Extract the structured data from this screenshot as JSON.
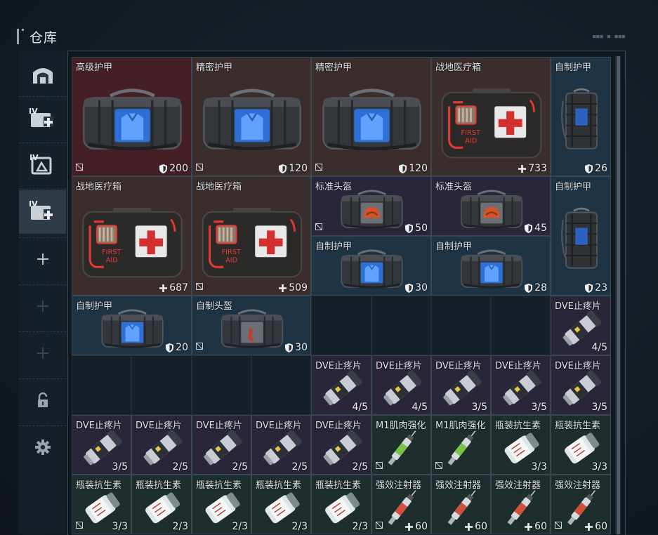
{
  "header": {
    "title": "仓库",
    "deco": "■■■ ■ ■■■"
  },
  "sidebar": [
    {
      "id": "base",
      "icon": "base-icon",
      "active": false
    },
    {
      "id": "medical-iv-1",
      "icon": "medical-iv-icon",
      "active": false,
      "label": "IV"
    },
    {
      "id": "medical-iv-2",
      "icon": "medical-iv-outline-icon",
      "active": false,
      "label": "IV"
    },
    {
      "id": "medical-iv-3",
      "icon": "medical-iv-icon",
      "active": true,
      "label": "IV"
    },
    {
      "id": "add-1",
      "icon": "plus-icon",
      "active": false
    },
    {
      "id": "add-2",
      "icon": "plus-dim-icon",
      "active": false
    },
    {
      "id": "add-3",
      "icon": "plus-dim-icon",
      "active": false
    },
    {
      "id": "lock",
      "icon": "lock-icon",
      "active": false
    },
    {
      "id": "settings",
      "icon": "gear-icon",
      "active": false
    }
  ],
  "colors": {
    "red": "#442026",
    "brown": "#3b2d2b",
    "blue": "#1e3344",
    "purple": "#2a2639",
    "green": "#1d2e2d",
    "accent": "#e53935"
  },
  "items": [
    {
      "name": "高级护甲",
      "qty": "200",
      "qtyIcon": "shield-icon",
      "kind": "bag-blue",
      "bg": "red",
      "flag": true,
      "col": 0,
      "row": 0,
      "w": 2,
      "h": 2
    },
    {
      "name": "精密护甲",
      "qty": "120",
      "qtyIcon": "shield-icon",
      "kind": "bag-blue",
      "bg": "brown",
      "flag": true,
      "col": 2,
      "row": 0,
      "w": 2,
      "h": 2
    },
    {
      "name": "精密护甲",
      "qty": "120",
      "qtyIcon": "shield-icon",
      "kind": "bag-blue",
      "bg": "brown",
      "flag": true,
      "col": 4,
      "row": 0,
      "w": 2,
      "h": 2
    },
    {
      "name": "战地医疗箱",
      "qty": "733",
      "qtyIcon": "plus-icon",
      "kind": "medkit",
      "bg": "brown",
      "flag": false,
      "col": 6,
      "row": 0,
      "w": 2,
      "h": 2
    },
    {
      "name": "自制护甲",
      "qty": "26",
      "qtyIcon": "shield-icon",
      "kind": "backpack",
      "bg": "blue",
      "flag": false,
      "col": 8,
      "row": 0,
      "w": 1,
      "h": 2
    },
    {
      "name": "战地医疗箱",
      "qty": "687",
      "qtyIcon": "plus-icon",
      "kind": "medkit",
      "bg": "brown",
      "flag": false,
      "col": 0,
      "row": 2,
      "w": 2,
      "h": 2
    },
    {
      "name": "战地医疗箱",
      "qty": "509",
      "qtyIcon": "plus-icon",
      "kind": "medkit",
      "bg": "brown",
      "flag": true,
      "col": 2,
      "row": 2,
      "w": 2,
      "h": 2
    },
    {
      "name": "标准头盔",
      "qty": "50",
      "qtyIcon": "shield-icon",
      "kind": "bag-helmet",
      "bg": "purple",
      "flag": true,
      "col": 4,
      "row": 2,
      "w": 2,
      "h": 1
    },
    {
      "name": "标准头盔",
      "qty": "45",
      "qtyIcon": "shield-icon",
      "kind": "bag-helmet",
      "bg": "purple",
      "flag": false,
      "col": 6,
      "row": 2,
      "w": 2,
      "h": 1
    },
    {
      "name": "自制护甲",
      "qty": "23",
      "qtyIcon": "shield-icon",
      "kind": "backpack",
      "bg": "blue",
      "flag": false,
      "col": 8,
      "row": 2,
      "w": 1,
      "h": 2
    },
    {
      "name": "自制护甲",
      "qty": "30",
      "qtyIcon": "shield-icon",
      "kind": "bag-small",
      "bg": "blue",
      "flag": false,
      "col": 4,
      "row": 3,
      "w": 2,
      "h": 1
    },
    {
      "name": "自制护甲",
      "qty": "28",
      "qtyIcon": "shield-icon",
      "kind": "bag-small",
      "bg": "blue",
      "flag": false,
      "col": 6,
      "row": 3,
      "w": 2,
      "h": 1
    },
    {
      "name": "自制护甲",
      "qty": "20",
      "qtyIcon": "shield-icon",
      "kind": "bag-small",
      "bg": "blue",
      "flag": false,
      "col": 0,
      "row": 4,
      "w": 2,
      "h": 1
    },
    {
      "name": "自制头盔",
      "qty": "30",
      "qtyIcon": "shield-icon",
      "kind": "bag-small-red",
      "bg": "blue",
      "flag": true,
      "col": 2,
      "row": 4,
      "w": 2,
      "h": 1
    },
    {
      "name": "DVE止疼片",
      "qty": "4/5",
      "qtyIcon": "",
      "kind": "pill",
      "bg": "purple",
      "flag": false,
      "col": 8,
      "row": 4,
      "w": 1,
      "h": 1
    },
    {
      "name": "DVE止疼片",
      "qty": "4/5",
      "qtyIcon": "",
      "kind": "pill",
      "bg": "purple",
      "flag": false,
      "col": 4,
      "row": 5,
      "w": 1,
      "h": 1
    },
    {
      "name": "DVE止疼片",
      "qty": "4/5",
      "qtyIcon": "",
      "kind": "pill",
      "bg": "purple",
      "flag": false,
      "col": 5,
      "row": 5,
      "w": 1,
      "h": 1
    },
    {
      "name": "DVE止疼片",
      "qty": "3/5",
      "qtyIcon": "",
      "kind": "pill",
      "bg": "purple",
      "flag": false,
      "col": 6,
      "row": 5,
      "w": 1,
      "h": 1
    },
    {
      "name": "DVE止疼片",
      "qty": "3/5",
      "qtyIcon": "",
      "kind": "pill",
      "bg": "purple",
      "flag": false,
      "col": 7,
      "row": 5,
      "w": 1,
      "h": 1
    },
    {
      "name": "DVE止疼片",
      "qty": "3/5",
      "qtyIcon": "",
      "kind": "pill",
      "bg": "purple",
      "flag": false,
      "col": 8,
      "row": 5,
      "w": 1,
      "h": 1
    },
    {
      "name": "DVE止疼片",
      "qty": "3/5",
      "qtyIcon": "",
      "kind": "pill",
      "bg": "purple",
      "flag": false,
      "col": 0,
      "row": 6,
      "w": 1,
      "h": 1
    },
    {
      "name": "DVE止疼片",
      "qty": "2/5",
      "qtyIcon": "",
      "kind": "pill",
      "bg": "purple",
      "flag": false,
      "col": 1,
      "row": 6,
      "w": 1,
      "h": 1
    },
    {
      "name": "DVE止疼片",
      "qty": "2/5",
      "qtyIcon": "",
      "kind": "pill",
      "bg": "purple",
      "flag": false,
      "col": 2,
      "row": 6,
      "w": 1,
      "h": 1
    },
    {
      "name": "DVE止疼片",
      "qty": "2/5",
      "qtyIcon": "",
      "kind": "pill",
      "bg": "purple",
      "flag": false,
      "col": 3,
      "row": 6,
      "w": 1,
      "h": 1
    },
    {
      "name": "DVE止疼片",
      "qty": "2/5",
      "qtyIcon": "",
      "kind": "pill",
      "bg": "purple",
      "flag": false,
      "col": 4,
      "row": 6,
      "w": 1,
      "h": 1
    },
    {
      "name": "M1肌肉强化",
      "qty": "",
      "qtyIcon": "",
      "kind": "syringe-green",
      "bg": "green",
      "flag": true,
      "col": 5,
      "row": 6,
      "w": 1,
      "h": 1
    },
    {
      "name": "M1肌肉强化",
      "qty": "",
      "qtyIcon": "",
      "kind": "syringe-green",
      "bg": "green",
      "flag": true,
      "col": 6,
      "row": 6,
      "w": 1,
      "h": 1
    },
    {
      "name": "瓶装抗生素",
      "qty": "3/3",
      "qtyIcon": "",
      "kind": "bottle",
      "bg": "green",
      "flag": false,
      "col": 7,
      "row": 6,
      "w": 1,
      "h": 1
    },
    {
      "name": "瓶装抗生素",
      "qty": "3/3",
      "qtyIcon": "",
      "kind": "bottle",
      "bg": "green",
      "flag": false,
      "col": 8,
      "row": 6,
      "w": 1,
      "h": 1
    },
    {
      "name": "瓶装抗生素",
      "qty": "3/3",
      "qtyIcon": "",
      "kind": "bottle",
      "bg": "green",
      "flag": true,
      "col": 0,
      "row": 7,
      "w": 1,
      "h": 1
    },
    {
      "name": "瓶装抗生素",
      "qty": "2/3",
      "qtyIcon": "",
      "kind": "bottle",
      "bg": "green",
      "flag": false,
      "col": 1,
      "row": 7,
      "w": 1,
      "h": 1
    },
    {
      "name": "瓶装抗生素",
      "qty": "2/3",
      "qtyIcon": "",
      "kind": "bottle",
      "bg": "green",
      "flag": false,
      "col": 2,
      "row": 7,
      "w": 1,
      "h": 1
    },
    {
      "name": "瓶装抗生素",
      "qty": "2/3",
      "qtyIcon": "",
      "kind": "bottle",
      "bg": "green",
      "flag": false,
      "col": 3,
      "row": 7,
      "w": 1,
      "h": 1
    },
    {
      "name": "瓶装抗生素",
      "qty": "2/3",
      "qtyIcon": "",
      "kind": "bottle",
      "bg": "green",
      "flag": false,
      "col": 4,
      "row": 7,
      "w": 1,
      "h": 1
    },
    {
      "name": "强效注射器",
      "qty": "60",
      "qtyIcon": "plus-icon",
      "kind": "syringe-red",
      "bg": "green",
      "flag": true,
      "col": 5,
      "row": 7,
      "w": 1,
      "h": 1
    },
    {
      "name": "强效注射器",
      "qty": "60",
      "qtyIcon": "plus-icon",
      "kind": "syringe-red",
      "bg": "green",
      "flag": false,
      "col": 6,
      "row": 7,
      "w": 1,
      "h": 1
    },
    {
      "name": "强效注射器",
      "qty": "60",
      "qtyIcon": "plus-icon",
      "kind": "syringe-red",
      "bg": "green",
      "flag": false,
      "col": 7,
      "row": 7,
      "w": 1,
      "h": 1
    },
    {
      "name": "强效注射器",
      "qty": "60",
      "qtyIcon": "plus-icon",
      "kind": "syringe-red",
      "bg": "green",
      "flag": true,
      "col": 8,
      "row": 7,
      "w": 1,
      "h": 1
    }
  ]
}
